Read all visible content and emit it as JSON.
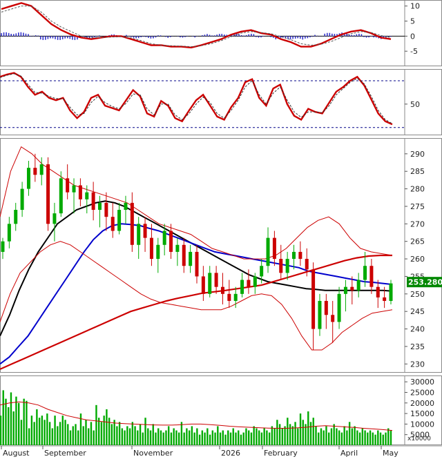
{
  "chart_data": [
    {
      "panel": "macd",
      "type": "line",
      "yticks": [
        10,
        5,
        0,
        -5
      ],
      "ylim": [
        -10,
        12
      ],
      "grid": false,
      "zero_line": true,
      "series": [
        {
          "role": "macd",
          "color": "#cc0000",
          "values": [
            9,
            10,
            11,
            10,
            7,
            4,
            2,
            0.5,
            -0.5,
            -1,
            -0.5,
            0,
            0,
            -1,
            -2,
            -3,
            -3,
            -3.5,
            -3.5,
            -3.8,
            -3,
            -2,
            -1,
            0.5,
            1.5,
            2,
            1,
            0.5,
            -1,
            -2,
            -3.5,
            -3.5,
            -2.5,
            -1,
            0.5,
            1.5,
            2,
            1,
            -0.5,
            -1
          ]
        },
        {
          "role": "signal",
          "color": "#555555",
          "dash": true,
          "values": [
            8,
            9,
            10,
            10,
            8,
            5,
            3,
            1.5,
            0,
            -0.5,
            -0.5,
            -0.3,
            -0.2,
            -0.6,
            -1.5,
            -2.5,
            -3,
            -3.2,
            -3.3,
            -3.5,
            -3.2,
            -2.5,
            -1.5,
            -0.2,
            1,
            1.5,
            1.2,
            0.8,
            -0.2,
            -1.2,
            -2.5,
            -3,
            -2.7,
            -1.8,
            -0.5,
            0.8,
            1.5,
            1.2,
            0.2,
            -0.5
          ]
        },
        {
          "role": "histogram",
          "colors": [
            "#3333cc",
            "#3333cc"
          ],
          "type": "bar",
          "values": [
            1,
            1,
            1,
            0,
            -1,
            -1,
            -1,
            -1,
            -0.5,
            -0.5,
            0,
            0.3,
            0.2,
            -0.4,
            -0.5,
            -0.5,
            0,
            -0.3,
            -0.2,
            -0.3,
            0.2,
            0.5,
            0.5,
            0.7,
            0.5,
            0.5,
            -0.2,
            -0.3,
            -0.8,
            -0.8,
            -1,
            -0.5,
            0.2,
            0.8,
            1,
            0.7,
            0.5,
            -0.2,
            -0.7,
            -0.5
          ]
        }
      ]
    },
    {
      "panel": "rsi",
      "type": "line",
      "yticks": [
        50
      ],
      "ylim": [
        10,
        95
      ],
      "reference_lines": [
        80,
        20
      ],
      "series": [
        {
          "role": "rsi",
          "color": "#cc0000",
          "values": [
            85,
            88,
            90,
            85,
            72,
            62,
            66,
            58,
            55,
            58,
            42,
            32,
            40,
            58,
            62,
            48,
            45,
            42,
            55,
            68,
            60,
            38,
            34,
            54,
            48,
            32,
            28,
            42,
            55,
            62,
            48,
            34,
            30,
            46,
            58,
            78,
            82,
            58,
            48,
            70,
            75,
            50,
            35,
            30,
            44,
            40,
            38,
            52,
            66,
            72,
            80,
            85,
            74,
            56,
            38,
            28,
            24
          ]
        },
        {
          "role": "signal",
          "color": "#333333",
          "dash": true,
          "values": [
            84,
            87,
            89,
            86,
            75,
            65,
            64,
            60,
            57,
            57,
            46,
            36,
            38,
            52,
            60,
            52,
            47,
            44,
            51,
            63,
            62,
            44,
            36,
            50,
            50,
            36,
            30,
            38,
            50,
            59,
            52,
            38,
            32,
            42,
            55,
            72,
            80,
            62,
            50,
            64,
            72,
            55,
            40,
            33,
            40,
            40,
            39,
            48,
            62,
            70,
            78,
            83,
            76,
            60,
            42,
            30,
            25
          ]
        }
      ]
    },
    {
      "panel": "price",
      "type": "candlestick",
      "yticks": [
        290,
        285,
        280,
        275,
        270,
        265,
        260,
        255,
        250,
        245,
        240,
        235,
        230
      ],
      "ylim": [
        227.5,
        294.5
      ],
      "last_price": "253.2800",
      "colors": {
        "up": "#00aa00",
        "down": "#cc0000",
        "ma_short": "#000000",
        "ma_mid": "#0000cc",
        "ma_long": "#cc0000",
        "bands": "#cc0000",
        "last_price_bg": "#008800"
      },
      "candles": [
        [
          262,
          266,
          260,
          265
        ],
        [
          265,
          272,
          263,
          270
        ],
        [
          270,
          276,
          268,
          274
        ],
        [
          274,
          282,
          272,
          280
        ],
        [
          280,
          288,
          278,
          286
        ],
        [
          286,
          290,
          282,
          284
        ],
        [
          284,
          289,
          281,
          287
        ],
        [
          287,
          289,
          268,
          270
        ],
        [
          270,
          276,
          265,
          273
        ],
        [
          273,
          285,
          272,
          283
        ],
        [
          283,
          287,
          277,
          279
        ],
        [
          279,
          283,
          273,
          281
        ],
        [
          281,
          283,
          275,
          277
        ],
        [
          277,
          281,
          273,
          279
        ],
        [
          279,
          282,
          271,
          274
        ],
        [
          274,
          278,
          269,
          276
        ],
        [
          276,
          279,
          268,
          272
        ],
        [
          272,
          276,
          266,
          268
        ],
        [
          268,
          276,
          267,
          274
        ],
        [
          274,
          278,
          270,
          276
        ],
        [
          276,
          279,
          262,
          264
        ],
        [
          264,
          272,
          260,
          270
        ],
        [
          270,
          272,
          262,
          266
        ],
        [
          266,
          270,
          258,
          260
        ],
        [
          260,
          266,
          256,
          264
        ],
        [
          264,
          270,
          261,
          268
        ],
        [
          268,
          270,
          260,
          262
        ],
        [
          262,
          266,
          258,
          264
        ],
        [
          264,
          266,
          256,
          258
        ],
        [
          258,
          264,
          256,
          262
        ],
        [
          262,
          264,
          253,
          255
        ],
        [
          255,
          258,
          248,
          250
        ],
        [
          250,
          258,
          249,
          256
        ],
        [
          256,
          258,
          250,
          252
        ],
        [
          252,
          256,
          247,
          250
        ],
        [
          250,
          254,
          246,
          248
        ],
        [
          248,
          252,
          246,
          250
        ],
        [
          250,
          256,
          249,
          254
        ],
        [
          254,
          257,
          250,
          252
        ],
        [
          252,
          256,
          250,
          255
        ],
        [
          255,
          260,
          253,
          258
        ],
        [
          258,
          269,
          256,
          266
        ],
        [
          266,
          268,
          258,
          260
        ],
        [
          260,
          264,
          254,
          256
        ],
        [
          256,
          262,
          254,
          260
        ],
        [
          260,
          264,
          257,
          262
        ],
        [
          262,
          265,
          258,
          260
        ],
        [
          260,
          263,
          255,
          257
        ],
        [
          257,
          259,
          234,
          240
        ],
        [
          240,
          250,
          238,
          248
        ],
        [
          248,
          250,
          240,
          244
        ],
        [
          244,
          248,
          236,
          242
        ],
        [
          242,
          252,
          240,
          250
        ],
        [
          250,
          254,
          245,
          252
        ],
        [
          252,
          255,
          247,
          251
        ],
        [
          251,
          256,
          249,
          254
        ],
        [
          254,
          262,
          252,
          258
        ],
        [
          258,
          260,
          250,
          252
        ],
        [
          252,
          254,
          246,
          249
        ],
        [
          249,
          252,
          246,
          248
        ],
        [
          248,
          254,
          247,
          253
        ]
      ],
      "series": [
        {
          "role": "ma_short",
          "values": [
            238,
            244,
            251,
            257,
            262,
            266,
            270,
            272,
            274,
            275,
            276,
            276.5,
            276,
            275,
            273.5,
            272,
            270.5,
            269,
            267.5,
            266,
            264.5,
            263,
            261.5,
            260,
            258.5,
            257,
            255.5,
            254.5,
            253.5,
            253,
            252.5,
            252,
            251.5,
            251.3,
            251,
            251,
            251,
            251,
            251,
            251,
            251,
            250.8
          ]
        },
        {
          "role": "ma_mid",
          "values": [
            230,
            232,
            235,
            238,
            242,
            246,
            250,
            254,
            258,
            262,
            265.5,
            268,
            269.5,
            270,
            269.8,
            269.5,
            268.7,
            268,
            267,
            266,
            265,
            264,
            263,
            262,
            261.5,
            261,
            260.5,
            260,
            259.5,
            259,
            258.5,
            258,
            257.5,
            256.5,
            256,
            255.5,
            255,
            254.5,
            254,
            253.5,
            253.3,
            253,
            252.7
          ]
        },
        {
          "role": "ma_long",
          "values": [
            228.5,
            230,
            231.5,
            233,
            234.5,
            236,
            237.5,
            239,
            240.5,
            242,
            243.5,
            245,
            246,
            247,
            248,
            248.8,
            249.5,
            250.2,
            250.6,
            251,
            251.5,
            252,
            252.5,
            253.5,
            254.5,
            255.5,
            256.5,
            257.5,
            258.5,
            259.5,
            260.3,
            260.8,
            261,
            261
          ]
        },
        {
          "role": "band_upper",
          "values": [
            272,
            285,
            292,
            290,
            287,
            285,
            283,
            281,
            280,
            279,
            278,
            277,
            276,
            274,
            272,
            270,
            269,
            268,
            267,
            265,
            263,
            262,
            261,
            260,
            260,
            260,
            261,
            263,
            266,
            269,
            271,
            272,
            270,
            266,
            263,
            262,
            261.5,
            261
          ]
        },
        {
          "role": "band_lower",
          "values": [
            242,
            250,
            256,
            259,
            262,
            264,
            265,
            264,
            262,
            260,
            258,
            256,
            254,
            252,
            250,
            248.5,
            247.5,
            247,
            246.5,
            246,
            245.5,
            245.5,
            245.5,
            246.5,
            248,
            249.5,
            250,
            249.5,
            247,
            243,
            238,
            234,
            234,
            236,
            239,
            241,
            243,
            244.5,
            245,
            245.5
          ]
        }
      ]
    },
    {
      "panel": "volume",
      "type": "bar",
      "multiplier_label": "x10000",
      "yticks": [
        30000,
        25000,
        20000,
        15000,
        10000,
        5000
      ],
      "ylim": [
        0,
        33000
      ],
      "bar_color": "#00aa00",
      "ma_color": "#cc0000",
      "values": [
        14000,
        26000,
        22000,
        18000,
        25000,
        16000,
        23000,
        20000,
        12000,
        22000,
        21000,
        8000,
        14000,
        11000,
        17000,
        13000,
        14000,
        12000,
        15000,
        11000,
        8000,
        14000,
        9000,
        11000,
        14000,
        12000,
        10000,
        7000,
        9000,
        10000,
        7000,
        15000,
        9000,
        12000,
        8000,
        11000,
        7000,
        19000,
        13000,
        11000,
        14000,
        17000,
        13000,
        10000,
        12000,
        9000,
        11000,
        8000,
        7000,
        9000,
        8000,
        11000,
        9000,
        7000,
        10000,
        6000,
        13000,
        8000,
        7000,
        10000,
        6000,
        8000,
        7000,
        6000,
        7000,
        9000,
        6000,
        8000,
        7000,
        6000,
        11000,
        6000,
        8000,
        7000,
        9000,
        6000,
        8000,
        5000,
        7000,
        6000,
        8000,
        5000,
        7000,
        6000,
        9000,
        6000,
        7000,
        5000,
        7000,
        6000,
        8000,
        6000,
        7000,
        5000,
        6000,
        8000,
        7000,
        6000,
        9000,
        8000,
        7000,
        6000,
        8000,
        7000,
        6000,
        9000,
        8000,
        12000,
        10000,
        8000,
        9000,
        13000,
        10000,
        9000,
        11000,
        8000,
        15000,
        12000,
        10000,
        16000,
        11000,
        13000,
        9000,
        6000,
        8000,
        7000,
        9000,
        6000,
        8000,
        10000,
        8000,
        7000,
        6000,
        9000,
        7000,
        11000,
        8000,
        9000,
        7000,
        6000,
        8000,
        7000,
        6000,
        7000,
        6000,
        5000,
        7000,
        6000,
        5000,
        6000,
        8000,
        7000
      ],
      "ma_values": [
        19000,
        20000,
        20500,
        20000,
        19000,
        17000,
        15500,
        14000,
        13000,
        12000,
        11500,
        11000,
        10500,
        10200,
        10000,
        9800,
        9600,
        9500,
        9500,
        9700,
        10000,
        10000,
        9700,
        9400,
        9000,
        8700,
        8500,
        8300,
        8100,
        8000,
        8000,
        8200,
        8500,
        9000,
        9200,
        9000,
        8700,
        8400,
        8000,
        7700,
        7400,
        7000
      ]
    },
    {
      "panel": "time_axis",
      "type": "labels",
      "labels": [
        "August",
        "September",
        "November",
        "2026",
        "February",
        "April",
        "May"
      ]
    }
  ]
}
